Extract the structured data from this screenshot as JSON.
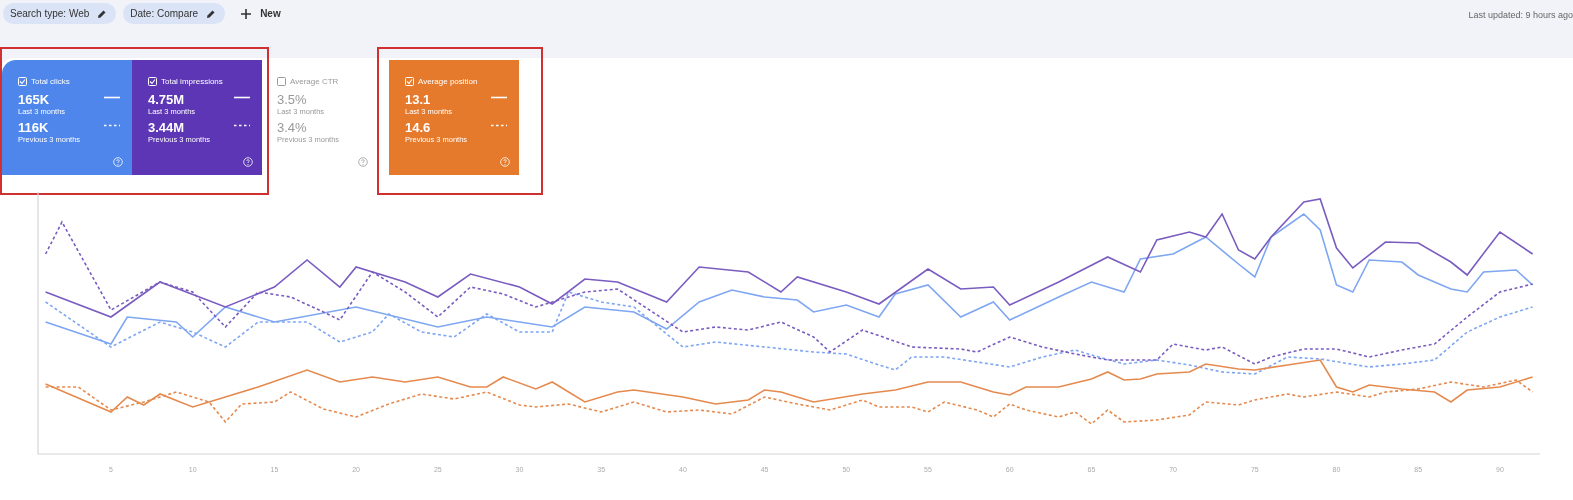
{
  "filters": [
    {
      "label": "Search type: Web"
    },
    {
      "label": "Date: Compare"
    }
  ],
  "new_button": {
    "label": "New"
  },
  "last_updated": "Last updated: 9 hours ago",
  "metrics": [
    {
      "label": "Total clicks",
      "checked": true,
      "highlighted": true,
      "color": "#4e86ec",
      "current_value": "165K",
      "current_period": "Last 3 months",
      "previous_value": "116K",
      "previous_period": "Previous 3 months"
    },
    {
      "label": "Total impressions",
      "checked": true,
      "highlighted": true,
      "color": "#5c36b4",
      "current_value": "4.75M",
      "current_period": "Last 3 months",
      "previous_value": "3.44M",
      "previous_period": "Previous 3 months"
    },
    {
      "label": "Average CTR",
      "checked": false,
      "highlighted": false,
      "current_value": "3.5%",
      "current_period": "Last 3 months",
      "previous_value": "3.4%",
      "previous_period": "Previous 3 months"
    },
    {
      "label": "Average position",
      "checked": true,
      "highlighted": true,
      "color": "#e67a2c",
      "current_value": "13.1",
      "current_period": "Last 3 months",
      "previous_value": "14.6",
      "previous_period": "Previous 3 months"
    }
  ],
  "chart": {
    "x_axis_labels": [
      "5",
      "10",
      "15",
      "20",
      "25",
      "30",
      "35",
      "40",
      "45",
      "50",
      "55",
      "60",
      "65",
      "70",
      "75",
      "80",
      "85",
      "90"
    ]
  }
}
